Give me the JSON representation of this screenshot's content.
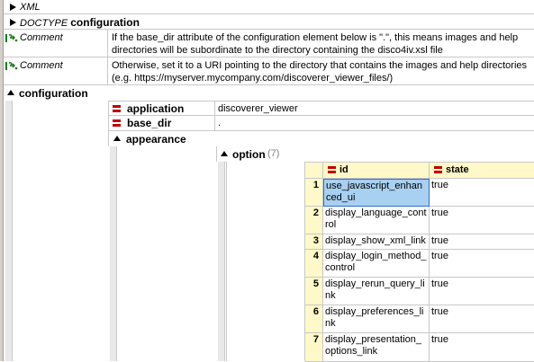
{
  "tree": {
    "xml_label": "XML",
    "doctype_keyword": "DOCTYPE",
    "doctype_name": "configuration",
    "comments": [
      {
        "label": "Comment",
        "text": "If the base_dir attribute of the configuration element below is \".\", this means images and help directories will be subordinate to the directory containing the disco4iv.xsl file"
      },
      {
        "label": "Comment",
        "text": "Otherwise, set it to a URI pointing to the directory that contains the images and help directories (e.g. https://myserver.mycompany.com/discoverer_viewer_files/)"
      }
    ],
    "root_element": "configuration",
    "attributes": [
      {
        "name": "application",
        "value": "discoverer_viewer"
      },
      {
        "name": "base_dir",
        "value": "."
      }
    ],
    "child_element": "appearance",
    "option_element": "option",
    "option_count": "(7)",
    "grid": {
      "columns": [
        "id",
        "state"
      ],
      "rows": [
        {
          "num": "1",
          "id": "use_javascript_enhanced_ui",
          "state": "true"
        },
        {
          "num": "2",
          "id": "display_language_control",
          "state": "true"
        },
        {
          "num": "3",
          "id": "display_show_xml_link",
          "state": "true"
        },
        {
          "num": "4",
          "id": "display_login_method_control",
          "state": "true"
        },
        {
          "num": "5",
          "id": "display_rerun_query_link",
          "state": "true"
        },
        {
          "num": "6",
          "id": "display_preferences_link",
          "state": "true"
        },
        {
          "num": "7",
          "id": "display_presentation_options_link",
          "state": "true"
        }
      ]
    }
  },
  "colors": {
    "gutter": "#d4d0c8",
    "attr_icon": "#c00000",
    "comment_icon": "#1a7a1a",
    "grid_header": "#fff8c8",
    "selection": "#a8d0f0"
  }
}
